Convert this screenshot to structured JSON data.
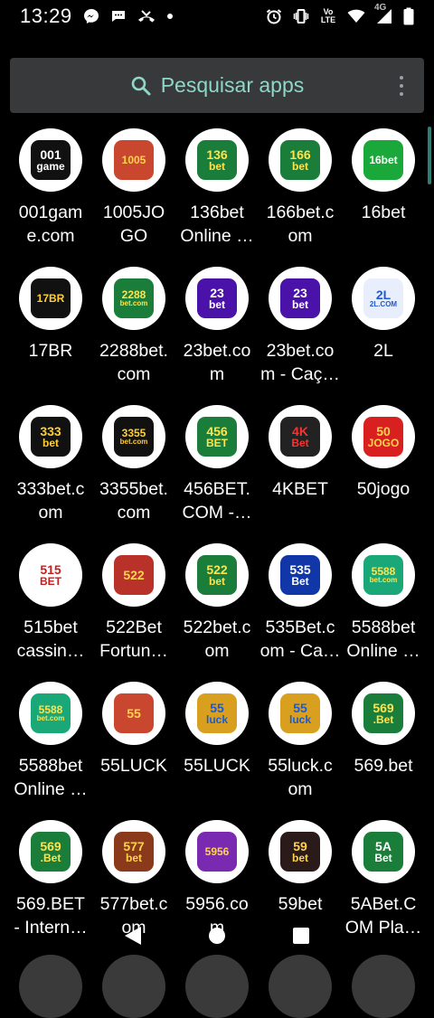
{
  "status_bar": {
    "time": "13:29",
    "left_icons": [
      "messenger-icon",
      "chat-bubble-icon",
      "missed-call-icon",
      "dot-icon"
    ],
    "right_icons": [
      "alarm-icon",
      "vibrate-icon",
      "volte-icon",
      "wifi-icon",
      "4g-signal-icon",
      "battery-icon"
    ],
    "volte_label": "Vo LTE",
    "network_label": "4G"
  },
  "search": {
    "placeholder": "Pesquisar apps",
    "accent": "#8fd7c9"
  },
  "apps": [
    {
      "label": "001gam\ne.com",
      "icon": "001game-icon",
      "badge1": "001",
      "badge2": "game",
      "bg": "#111111",
      "fg": "#ffffff"
    },
    {
      "label": "1005JO\nGO",
      "icon": "1005jogo-icon",
      "badge1": "1005",
      "badge2": "",
      "bg": "#c9472f",
      "fg": "#ffd34d"
    },
    {
      "label": "136bet\nOnline …",
      "icon": "136bet-icon",
      "badge1": "136",
      "badge2": "bet",
      "bg": "#1a7d3a",
      "fg": "#ffe34d"
    },
    {
      "label": "166bet.c\nom",
      "icon": "166bet-icon",
      "badge1": "166",
      "badge2": "bet",
      "bg": "#1a7d3a",
      "fg": "#ffe34d"
    },
    {
      "label": "16bet",
      "icon": "16bet-icon",
      "badge1": "16bet",
      "badge2": "",
      "bg": "#1aa83a",
      "fg": "#ffffff"
    },
    {
      "label": "17BR",
      "icon": "17br-icon",
      "badge1": "17BR",
      "badge2": "",
      "bg": "#111111",
      "fg": "#ffcf2e"
    },
    {
      "label": "2288bet.\ncom",
      "icon": "2288bet-icon",
      "badge1": "2288",
      "badge2": "bet.com",
      "bg": "#1a7d3a",
      "fg": "#ffe34d"
    },
    {
      "label": "23bet.co\nm",
      "icon": "23bet-icon",
      "badge1": "23",
      "badge2": "bet",
      "bg": "#4a12a8",
      "fg": "#ffffff"
    },
    {
      "label": "23bet.co\nm - Caç…",
      "icon": "23bet-cacaniquel-icon",
      "badge1": "23",
      "badge2": "bet",
      "bg": "#4a12a8",
      "fg": "#ffffff"
    },
    {
      "label": "2L",
      "icon": "2l-icon",
      "badge1": "2L",
      "badge2": "2L.COM",
      "bg": "#e8eefc",
      "fg": "#1f5ad6"
    },
    {
      "label": "333bet.c\nom",
      "icon": "333bet-icon",
      "badge1": "333",
      "badge2": "bet",
      "bg": "#111111",
      "fg": "#ffcf2e"
    },
    {
      "label": "3355bet.\ncom",
      "icon": "3355bet-icon",
      "badge1": "3355",
      "badge2": "bet.com",
      "bg": "#111111",
      "fg": "#ffcf2e"
    },
    {
      "label": "456BET.\nCOM -…",
      "icon": "456bet-icon",
      "badge1": "456",
      "badge2": "BET",
      "bg": "#1a7d3a",
      "fg": "#ffe34d"
    },
    {
      "label": "4KBET",
      "icon": "4kbet-icon",
      "badge1": "4K",
      "badge2": "Bet",
      "bg": "#222222",
      "fg": "#ff3030"
    },
    {
      "label": "50jogo",
      "icon": "50jogo-icon",
      "badge1": "50",
      "badge2": "JOGO",
      "bg": "#d92020",
      "fg": "#ffd34d"
    },
    {
      "label": "515bet\ncassin…",
      "icon": "515bet-icon",
      "badge1": "515",
      "badge2": "BET",
      "bg": "#ffffff",
      "fg": "#c41f1f"
    },
    {
      "label": "522Bet\nFortun…",
      "icon": "522bet-fortune-icon",
      "badge1": "522",
      "badge2": "",
      "bg": "#b8322a",
      "fg": "#ffd34d"
    },
    {
      "label": "522bet.c\nom",
      "icon": "522bet-icon",
      "badge1": "522",
      "badge2": "bet",
      "bg": "#1a7d3a",
      "fg": "#ffe34d"
    },
    {
      "label": "535Bet.c\nom - Ca…",
      "icon": "535bet-icon",
      "badge1": "535",
      "badge2": "Bet",
      "bg": "#1036a8",
      "fg": "#ffffff"
    },
    {
      "label": "5588bet\nOnline …",
      "icon": "5588bet-icon",
      "badge1": "5588",
      "badge2": "bet.com",
      "bg": "#1aa878",
      "fg": "#ffe34d"
    },
    {
      "label": "5588bet\nOnline …",
      "icon": "5588bet-online-icon",
      "badge1": "5588",
      "badge2": "bet.com",
      "bg": "#1aa878",
      "fg": "#ffe34d"
    },
    {
      "label": "55LUCK",
      "icon": "55luck-icon",
      "badge1": "55",
      "badge2": "",
      "bg": "#c9472f",
      "fg": "#ffd34d"
    },
    {
      "label": "55LUCK",
      "icon": "55luck-dragon-icon",
      "badge1": "55",
      "badge2": "luck",
      "bg": "#d9a020",
      "fg": "#1a5ad6"
    },
    {
      "label": "55luck.c\nom",
      "icon": "55luck-com-icon",
      "badge1": "55",
      "badge2": "luck",
      "bg": "#d9a020",
      "fg": "#1a5ad6"
    },
    {
      "label": "569.bet",
      "icon": "569bet-icon",
      "badge1": "569",
      "badge2": ".Bet",
      "bg": "#1a7d3a",
      "fg": "#ffe34d"
    },
    {
      "label": "569.BET\n- Intern…",
      "icon": "569bet-international-icon",
      "badge1": "569",
      "badge2": ".Bet",
      "bg": "#1a7d3a",
      "fg": "#ffe34d"
    },
    {
      "label": "577bet.c\nom",
      "icon": "577bet-icon",
      "badge1": "577",
      "badge2": "bet",
      "bg": "#8a3a1a",
      "fg": "#ffd34d"
    },
    {
      "label": "5956.co\nm",
      "icon": "5956-icon",
      "badge1": "5956",
      "badge2": "",
      "bg": "#7a2ab0",
      "fg": "#ffd34d"
    },
    {
      "label": "59bet",
      "icon": "59bet-icon",
      "badge1": "59",
      "badge2": "bet",
      "bg": "#2a1a1a",
      "fg": "#ffd34d"
    },
    {
      "label": "5ABet.C\nOM Pla…",
      "icon": "5abet-icon",
      "badge1": "5A",
      "badge2": "Bet",
      "bg": "#1a7d3a",
      "fg": "#ffffff"
    }
  ],
  "nav": {
    "back": "back-icon",
    "home": "home-icon",
    "recents": "recents-icon"
  }
}
